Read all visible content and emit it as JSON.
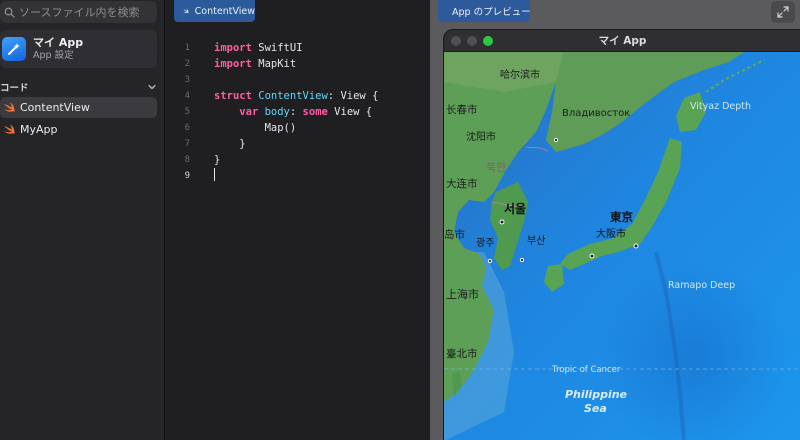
{
  "sidebar": {
    "search_placeholder": "ソースファイル内を検索",
    "project": {
      "name": "マイ App",
      "subtitle": "App 設定"
    },
    "section_title": "コード",
    "files": [
      {
        "label": "ContentView",
        "selected": true
      },
      {
        "label": "MyApp",
        "selected": false
      }
    ]
  },
  "editor": {
    "tab_label": "ContentView",
    "line_numbers": [
      "1",
      "2",
      "3",
      "4",
      "5",
      "6",
      "7",
      "8",
      "9"
    ],
    "code": {
      "l1_kw": "import",
      "l1_rest": " SwiftUI",
      "l2_kw": "import",
      "l2_rest": " MapKit",
      "l4_kw": "struct",
      "l4_name": " ContentView",
      "l4_colon": ": ",
      "l4_type": "View",
      "l4_brace": " {",
      "l5_indent": "    ",
      "l5_kw": "var",
      "l5_sp": " ",
      "l5_prop": "body",
      "l5_colon": ": ",
      "l5_kw2": "some",
      "l5_sp2": " ",
      "l5_type": "View",
      "l5_brace": " {",
      "l6": "        Map()",
      "l7": "    }",
      "l8": "}"
    }
  },
  "preview": {
    "tab_label": "App のプレビュー",
    "window_title": "マイ App"
  },
  "map": {
    "labels": {
      "harbin": "哈尔滨市",
      "changchun": "长春市",
      "vladivostok": "Владивосток",
      "vityaz": "Vityaz Depth",
      "shenyang": "沈阳市",
      "north_korea": "북한",
      "dalian": "大连市",
      "seoul": "서울",
      "tokyo": "東京",
      "osaka": "大阪市",
      "gwangju": "광주",
      "busan": "부산",
      "qingdao": "岛市",
      "ramapo": "Ramapo Deep",
      "shanghai": "上海市",
      "taipei": "臺北市",
      "tropic": "Tropic of Cancer",
      "philippine": "Philippine",
      "sea": "Sea"
    }
  },
  "colors": {
    "accent_tab": "#2c5a9a",
    "keyword": "#fc5fa3",
    "type": "#5dd8ff",
    "ocean": "#1f86e0",
    "land": "#5d9f57",
    "traffic_green": "#2ac940"
  }
}
